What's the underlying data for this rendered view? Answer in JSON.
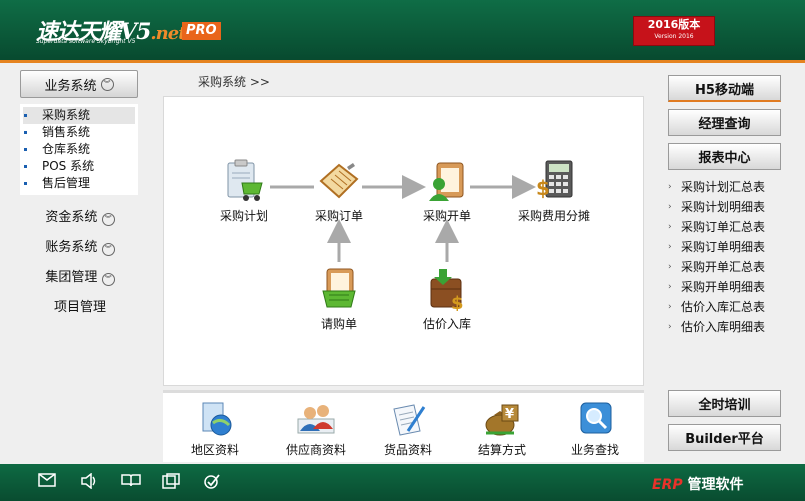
{
  "header": {
    "logo_cn": "速达天耀V5",
    "logo_net": ".net",
    "logo_sub": "Superdata software Skybright V5",
    "pro": "PRO",
    "version_main": "2016版本",
    "version_sub": "Version 2016"
  },
  "left_nav": {
    "section_title": "业务系统",
    "sub_items": [
      "采购系统",
      "销售系统",
      "仓库系统",
      "POS 系统",
      "售后管理"
    ],
    "selected_index": 0,
    "groups": [
      "资金系统",
      "账务系统",
      "集团管理",
      "项目管理"
    ]
  },
  "breadcrumb": "采购系统 >>",
  "flow": {
    "nodes": {
      "plan": "采购计划",
      "order": "采购订单",
      "invoice": "采购开单",
      "cost": "采购费用分摊",
      "request": "请购单",
      "estimate": "估价入库"
    }
  },
  "bottom_bar": {
    "items": [
      "地区资料",
      "供应商资料",
      "货品资料",
      "结算方式",
      "业务查找"
    ]
  },
  "right_panel": {
    "buttons": [
      "H5移动端",
      "经理查询",
      "报表中心"
    ],
    "reports": [
      "采购计划汇总表",
      "采购计划明细表",
      "采购订单汇总表",
      "采购订单明细表",
      "采购开单汇总表",
      "采购开单明细表",
      "估价入库汇总表",
      "估价入库明细表"
    ],
    "bottom_buttons": [
      "全时培训",
      "Builder平台"
    ]
  },
  "footer": {
    "icons": [
      "mail-icon",
      "sound-icon",
      "book-icon",
      "window-icon",
      "check-icon"
    ],
    "brand_erp": "ERP",
    "brand_text": " 管理软件"
  },
  "colors": {
    "header_green": "#0f6d46",
    "accent_orange": "#e58320",
    "version_red": "#c6121a"
  }
}
